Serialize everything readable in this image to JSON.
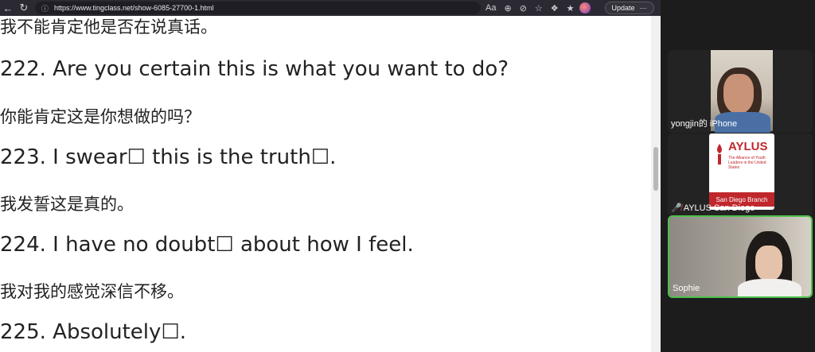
{
  "browser": {
    "url": "https://www.tingclass.net/show-6085-27700-1.html",
    "update_label": "Update",
    "more_label": "···"
  },
  "lines": [
    {
      "zh": "我不能肯定他是否在说真话。"
    },
    {
      "en": "222. Are you certain this is what you want to do?",
      "zh": "你能肯定这是你想做的吗？"
    },
    {
      "en": "223. I swear☐ this is the truth☐.",
      "zh": "我发誓这是真的。"
    },
    {
      "en": "224. I have no doubt☐ about how I feel.",
      "zh": "我对我的感觉深信不移。"
    },
    {
      "en": "225. Absolutely☐."
    }
  ],
  "participants": [
    {
      "name": "yongjin的 iPhone"
    },
    {
      "name": "AYLUS San Diego",
      "muted": true,
      "logo": {
        "title": "AYLUS",
        "subtitle": "The Alliance of Youth Leaders in the United States",
        "band": "San Diego Branch"
      }
    },
    {
      "name": "Sophie",
      "active_speaker": true
    }
  ],
  "colors": {
    "accent_green": "#4ec14e",
    "brand_red": "#c0272d"
  }
}
